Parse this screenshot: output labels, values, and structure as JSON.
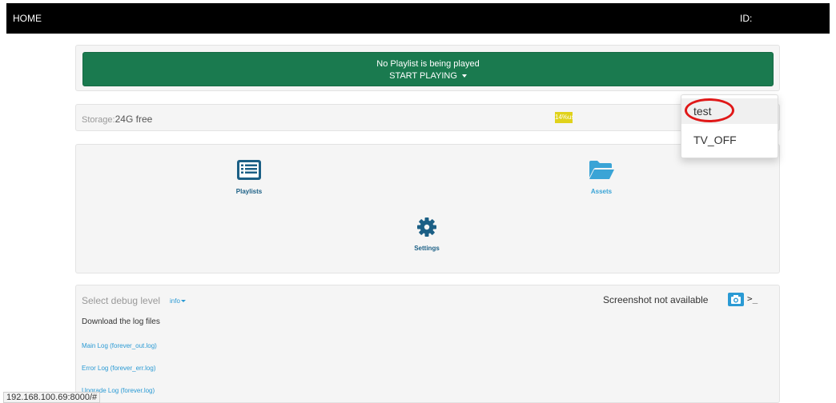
{
  "topbar": {
    "home": "HOME",
    "id_label": "ID:"
  },
  "player": {
    "status": "No Playlist is being played",
    "start_label": "START PLAYING"
  },
  "storage": {
    "label": "Storage:",
    "value": "24G free",
    "used_label": "14%used",
    "used_fraction": 0.14
  },
  "dropdown": {
    "items": [
      "test",
      "TV_OFF"
    ]
  },
  "tiles": {
    "playlists": "Playlists",
    "assets": "Assets",
    "settings": "Settings"
  },
  "logs": {
    "debug_label": "Select debug level",
    "debug_value": "info",
    "download_label": "Download the log files",
    "links": [
      "Main Log (forever_out.log)",
      "Error Log (forever_err.log)",
      "Upgrade Log (forever.log)"
    ],
    "screenshot_status": "Screenshot not available",
    "terminal_label": ">_"
  },
  "status_url": "192.168.100.69:8000/#",
  "colors": {
    "player_green": "#1a7a4f",
    "link_blue": "#2a9ad4",
    "icon_blue": "#1b5f85",
    "storage_fill": "#e0d21b",
    "annotation_red": "#e01818"
  }
}
